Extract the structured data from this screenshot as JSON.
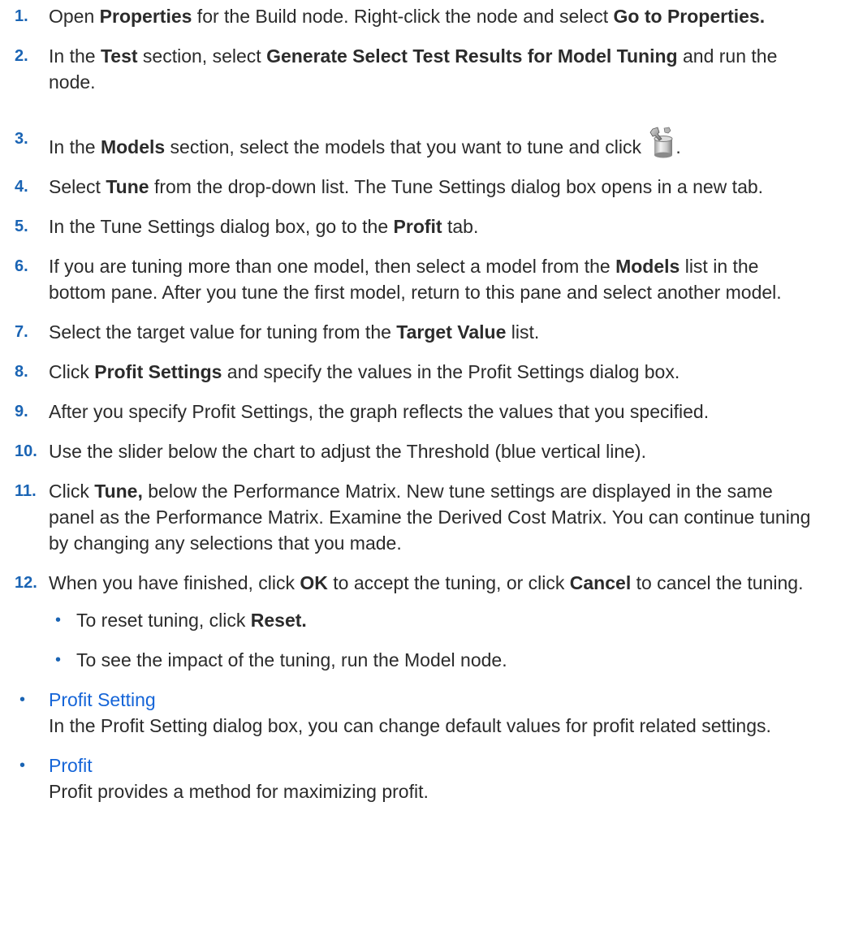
{
  "steps": [
    {
      "num": "1.",
      "parts": [
        {
          "t": "Open "
        },
        {
          "t": "Properties",
          "b": true
        },
        {
          "t": " for the Build node. Right-click the node and select "
        },
        {
          "t": "Go to Properties.",
          "b": true
        }
      ]
    },
    {
      "num": "2.",
      "parts": [
        {
          "t": "In the "
        },
        {
          "t": "Test",
          "b": true
        },
        {
          "t": " section, select "
        },
        {
          "t": "Generate Select Test Results for Model Tuning",
          "b": true
        },
        {
          "t": " and run the node."
        }
      ]
    },
    {
      "num": "3.",
      "tall": true,
      "icon": "tune-settings-icon",
      "parts": [
        {
          "t": "In the "
        },
        {
          "t": "Models",
          "b": true
        },
        {
          "t": " section, select the models that you want to tune and click "
        }
      ],
      "after_icon": "."
    },
    {
      "num": "4.",
      "parts": [
        {
          "t": "Select "
        },
        {
          "t": "Tune",
          "b": true
        },
        {
          "t": " from the drop-down list. The Tune Settings dialog box opens in a new tab."
        }
      ]
    },
    {
      "num": "5.",
      "parts": [
        {
          "t": "In the Tune Settings dialog box, go to the "
        },
        {
          "t": "Profit",
          "b": true
        },
        {
          "t": " tab."
        }
      ]
    },
    {
      "num": "6.",
      "parts": [
        {
          "t": "If you are tuning more than one model, then select a model from the "
        },
        {
          "t": "Models",
          "b": true
        },
        {
          "t": " list in the bottom pane. After you tune the first model, return to this pane and select another model."
        }
      ]
    },
    {
      "num": "7.",
      "parts": [
        {
          "t": "Select the target value for tuning from the "
        },
        {
          "t": "Target Value",
          "b": true
        },
        {
          "t": " list."
        }
      ]
    },
    {
      "num": "8.",
      "parts": [
        {
          "t": "Click "
        },
        {
          "t": "Profit Settings",
          "b": true
        },
        {
          "t": " and specify the values in the Profit Settings dialog box."
        }
      ]
    },
    {
      "num": "9.",
      "parts": [
        {
          "t": "After you specify Profit Settings, the graph reflects the values that you specified."
        }
      ]
    },
    {
      "num": "10.",
      "parts": [
        {
          "t": "Use the slider below the chart to adjust the Threshold (blue vertical line)."
        }
      ]
    },
    {
      "num": "11.",
      "parts": [
        {
          "t": "Click "
        },
        {
          "t": "Tune,",
          "b": true
        },
        {
          "t": " below the Performance Matrix. New tune settings are displayed in the same panel as the Performance Matrix. Examine the Derived Cost Matrix. You can continue tuning by changing any selections that you made."
        }
      ]
    },
    {
      "num": "12.",
      "parts": [
        {
          "t": "When you have finished, click "
        },
        {
          "t": "OK",
          "b": true
        },
        {
          "t": " to accept the tuning, or click "
        },
        {
          "t": "Cancel",
          "b": true
        },
        {
          "t": " to cancel the tuning."
        }
      ],
      "sub": [
        {
          "parts": [
            {
              "t": "To reset tuning, click "
            },
            {
              "t": "Reset.",
              "b": true
            }
          ]
        },
        {
          "parts": [
            {
              "t": "To see the impact of the tuning, run the Model node."
            }
          ]
        }
      ]
    }
  ],
  "bullet_glyph": "•",
  "links": [
    {
      "title": "Profit Setting",
      "desc": "In the Profit Setting dialog box, you can change default values for profit related settings."
    },
    {
      "title": "Profit",
      "desc": "Profit provides a method for maximizing profit."
    }
  ],
  "colors": {
    "step_number": "#1a64b4",
    "link": "#1565d8",
    "text": "#2b2b2b"
  }
}
